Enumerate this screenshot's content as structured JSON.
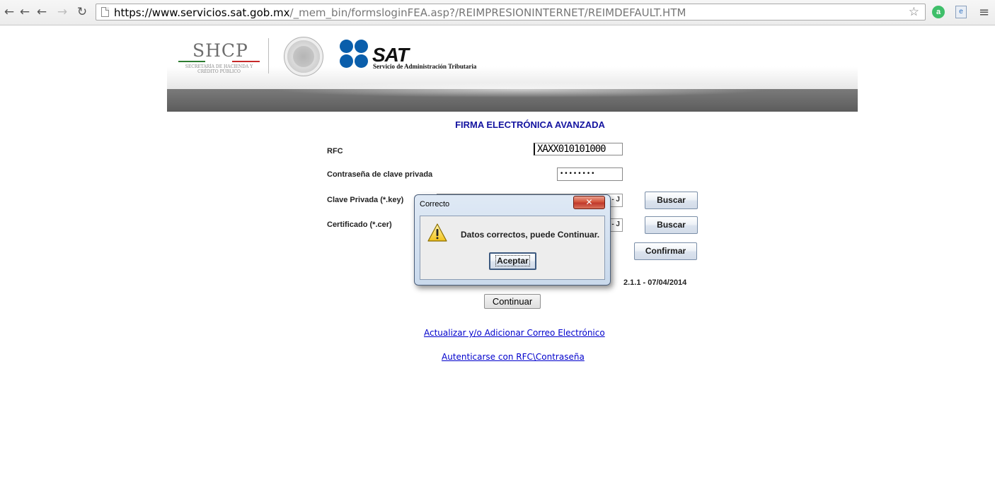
{
  "browser": {
    "url_host": "https://www.servicios.sat.gob.mx",
    "url_path": "/_mem_bin/formsloginFEA.asp?/REIMPRESIONINTERNET/REIMDEFAULT.HTM",
    "icons": [
      "back-icon",
      "back-history-icon",
      "forward-icon",
      "reload-icon",
      "page-icon",
      "bookmark-star-icon",
      "extension-icon",
      "extension-icon",
      "menu-icon"
    ]
  },
  "banner": {
    "shcp_title": "SHCP",
    "shcp_subtitle": "SECRETARÍA DE HACIENDA Y CRÉDITO PÚBLICO",
    "sat_title": "SAT",
    "sat_subtitle": "Servicio de Administración Tributaria",
    "colors": {
      "sat_blue": "#0a5eab",
      "band_gray": "#6a6a6a"
    }
  },
  "form": {
    "title": "FIRMA ELECTRÓNICA AVANZADA",
    "rfc_label": "RFC",
    "rfc_value": "XAXX010101000",
    "password_label": "Contraseña de clave privada",
    "password_value": "••••••••",
    "key_label": "Clave Privada (*.key)",
    "key_suffix": "- J",
    "cert_label": "Certificado (*.cer)",
    "cert_suffix": "- J",
    "search_label_1": "Buscar",
    "search_label_2": "Buscar",
    "confirm_label": "Confirmar",
    "version": "2.1.1 - 07/04/2014",
    "continue_label": "Continuar",
    "title_color": "#1414a0"
  },
  "links": {
    "update_email": "Actualizar y/o Adicionar Correo Electrónico",
    "auth_rfc": "Autenticarse con RFC\\Contraseña"
  },
  "dialog": {
    "title": "Correcto",
    "close_glyph": "✕",
    "message": "Datos correctos, puede Continuar.",
    "ok_label": "Aceptar",
    "icon": "warning-icon"
  }
}
